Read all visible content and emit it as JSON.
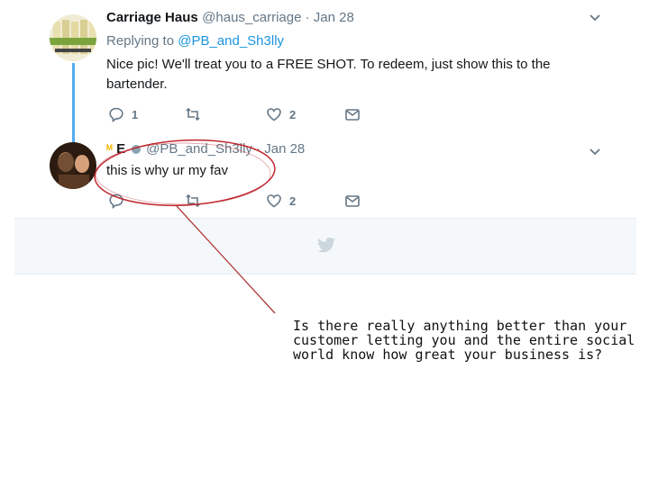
{
  "tweet1": {
    "display_name": "Carriage Haus",
    "handle_date": "@haus_carriage · Jan 28",
    "replying_label": "Replying to",
    "replying_handle": "@PB_and_Sh3lly",
    "text": "Nice pic!  We'll treat you to a FREE SHOT. To redeem, just show this to the bartender.",
    "reply_count": "1",
    "like_count": "2"
  },
  "tweet2": {
    "display_name": "E",
    "handle_date": "@PB_and_Sh3lly · Jan 28",
    "text": "this is why ur my fav",
    "like_count": "2"
  },
  "annotation": {
    "text": "Is there really anything better than your\ncustomer letting you and the entire social\nworld know how great your business is?"
  },
  "colors": {
    "accent": "#1b95e0",
    "thread_line": "#55acee",
    "muted": "#657786",
    "circle": "#c0282f",
    "band_bg": "#f5f8fa"
  },
  "icons": [
    "reply-icon",
    "retweet-icon",
    "like-icon",
    "dm-icon",
    "chevron-down-icon",
    "twitter-bird-icon"
  ]
}
